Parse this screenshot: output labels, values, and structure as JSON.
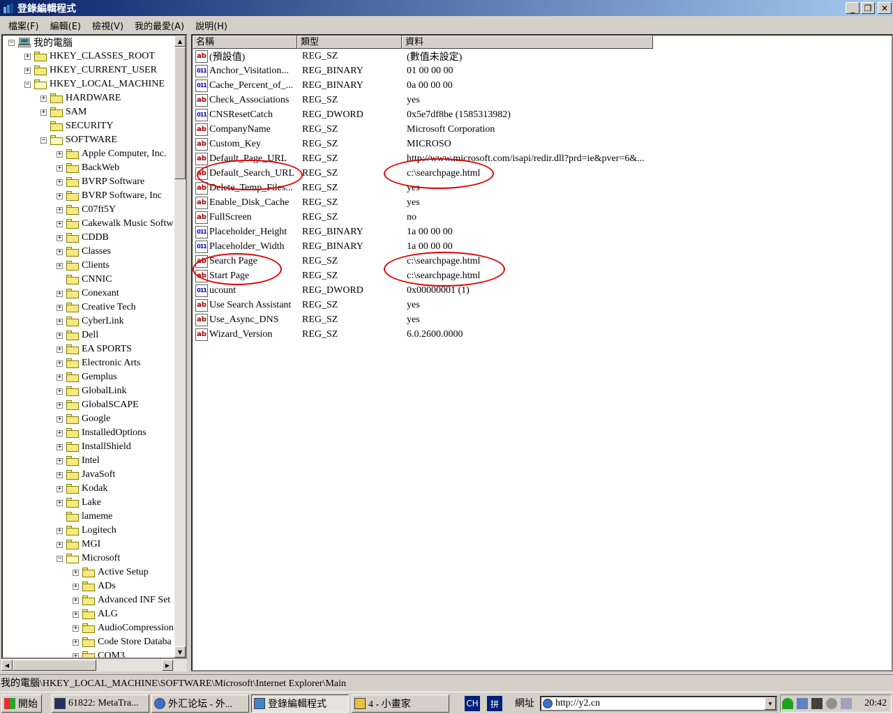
{
  "window": {
    "title": "登錄編輯程式",
    "min_label": "_",
    "restore_label": "❐",
    "close_label": "✕"
  },
  "menu": [
    "檔案(F)",
    "編輯(E)",
    "檢視(V)",
    "我的最愛(A)",
    "說明(H)"
  ],
  "tree": {
    "items": [
      {
        "label": "我的電腦",
        "exp": "−",
        "level": 0,
        "icon": "computer"
      },
      {
        "label": "HKEY_CLASSES_ROOT",
        "exp": "+",
        "level": 1
      },
      {
        "label": "HKEY_CURRENT_USER",
        "exp": "+",
        "level": 1
      },
      {
        "label": "HKEY_LOCAL_MACHINE",
        "exp": "−",
        "level": 1,
        "open": true
      },
      {
        "label": "HARDWARE",
        "exp": "+",
        "level": 2
      },
      {
        "label": "SAM",
        "exp": "+",
        "level": 2
      },
      {
        "label": "SECURITY",
        "exp": "",
        "level": 2
      },
      {
        "label": "SOFTWARE",
        "exp": "−",
        "level": 2,
        "open": true
      },
      {
        "label": "Apple Computer, Inc.",
        "exp": "+",
        "level": 3
      },
      {
        "label": "BackWeb",
        "exp": "+",
        "level": 3
      },
      {
        "label": "BVRP Software",
        "exp": "+",
        "level": 3
      },
      {
        "label": "BVRP Software, Inc",
        "exp": "+",
        "level": 3
      },
      {
        "label": "C07ft5Y",
        "exp": "+",
        "level": 3
      },
      {
        "label": "Cakewalk Music Softw",
        "exp": "+",
        "level": 3
      },
      {
        "label": "CDDB",
        "exp": "+",
        "level": 3
      },
      {
        "label": "Classes",
        "exp": "+",
        "level": 3
      },
      {
        "label": "Clients",
        "exp": "+",
        "level": 3
      },
      {
        "label": "CNNIC",
        "exp": "",
        "level": 3
      },
      {
        "label": "Conexant",
        "exp": "+",
        "level": 3
      },
      {
        "label": "Creative Tech",
        "exp": "+",
        "level": 3
      },
      {
        "label": "CyberLink",
        "exp": "+",
        "level": 3
      },
      {
        "label": "Dell",
        "exp": "+",
        "level": 3
      },
      {
        "label": "EA SPORTS",
        "exp": "+",
        "level": 3
      },
      {
        "label": "Electronic Arts",
        "exp": "+",
        "level": 3
      },
      {
        "label": "Gemplus",
        "exp": "+",
        "level": 3
      },
      {
        "label": "GlobalLink",
        "exp": "+",
        "level": 3
      },
      {
        "label": "GlobalSCAPE",
        "exp": "+",
        "level": 3
      },
      {
        "label": "Google",
        "exp": "+",
        "level": 3
      },
      {
        "label": "InstalledOptions",
        "exp": "+",
        "level": 3
      },
      {
        "label": "InstallShield",
        "exp": "+",
        "level": 3
      },
      {
        "label": "Intel",
        "exp": "+",
        "level": 3
      },
      {
        "label": "JavaSoft",
        "exp": "+",
        "level": 3
      },
      {
        "label": "Kodak",
        "exp": "+",
        "level": 3
      },
      {
        "label": "Lake",
        "exp": "+",
        "level": 3
      },
      {
        "label": "lameme",
        "exp": "",
        "level": 3
      },
      {
        "label": "Logitech",
        "exp": "+",
        "level": 3
      },
      {
        "label": "MGI",
        "exp": "+",
        "level": 3
      },
      {
        "label": "Microsoft",
        "exp": "−",
        "level": 3,
        "open": true
      },
      {
        "label": "Active Setup",
        "exp": "+",
        "level": 4
      },
      {
        "label": "ADs",
        "exp": "+",
        "level": 4
      },
      {
        "label": "Advanced INF Set",
        "exp": "+",
        "level": 4
      },
      {
        "label": "ALG",
        "exp": "+",
        "level": 4
      },
      {
        "label": "AudioCompression",
        "exp": "+",
        "level": 4
      },
      {
        "label": "Code Store Databa",
        "exp": "+",
        "level": 4
      },
      {
        "label": "COM3",
        "exp": "+",
        "level": 4
      }
    ]
  },
  "list": {
    "headers": [
      "名稱",
      "類型",
      "資料"
    ],
    "rows": [
      {
        "icon": "ab",
        "name": "(預設值)",
        "type": "REG_SZ",
        "data": "(數值未設定)"
      },
      {
        "icon": "bin",
        "name": "Anchor_Visitation...",
        "type": "REG_BINARY",
        "data": "01 00 00 00"
      },
      {
        "icon": "bin",
        "name": "Cache_Percent_of_...",
        "type": "REG_BINARY",
        "data": "0a 00 00 00"
      },
      {
        "icon": "ab",
        "name": "Check_Associations",
        "type": "REG_SZ",
        "data": "yes"
      },
      {
        "icon": "bin",
        "name": "CNSResetCatch",
        "type": "REG_DWORD",
        "data": "0x5e7df8be (1585313982)"
      },
      {
        "icon": "ab",
        "name": "CompanyName",
        "type": "REG_SZ",
        "data": "Microsoft Corporation"
      },
      {
        "icon": "ab",
        "name": "Custom_Key",
        "type": "REG_SZ",
        "data": "MICROSO"
      },
      {
        "icon": "ab",
        "name": "Default_Page_URL",
        "type": "REG_SZ",
        "data": "http://www.microsoft.com/isapi/redir.dll?prd=ie&pver=6&..."
      },
      {
        "icon": "ab",
        "name": "Default_Search_URL",
        "type": "REG_SZ",
        "data": "c:\\searchpage.html"
      },
      {
        "icon": "ab",
        "name": "Delete_Temp_Files...",
        "type": "REG_SZ",
        "data": "yes"
      },
      {
        "icon": "ab",
        "name": "Enable_Disk_Cache",
        "type": "REG_SZ",
        "data": "yes"
      },
      {
        "icon": "ab",
        "name": "FullScreen",
        "type": "REG_SZ",
        "data": "no"
      },
      {
        "icon": "bin",
        "name": "Placeholder_Height",
        "type": "REG_BINARY",
        "data": "1a 00 00 00"
      },
      {
        "icon": "bin",
        "name": "Placeholder_Width",
        "type": "REG_BINARY",
        "data": "1a 00 00 00"
      },
      {
        "icon": "ab",
        "name": "Search Page",
        "type": "REG_SZ",
        "data": "c:\\searchpage.html"
      },
      {
        "icon": "ab",
        "name": "Start Page",
        "type": "REG_SZ",
        "data": "c:\\searchpage.html"
      },
      {
        "icon": "bin",
        "name": "ucount",
        "type": "REG_DWORD",
        "data": "0x00000001 (1)"
      },
      {
        "icon": "ab",
        "name": "Use Search Assistant",
        "type": "REG_SZ",
        "data": "yes"
      },
      {
        "icon": "ab",
        "name": "Use_Async_DNS",
        "type": "REG_SZ",
        "data": "yes"
      },
      {
        "icon": "ab",
        "name": "Wizard_Version",
        "type": "REG_SZ",
        "data": "6.0.2600.0000"
      }
    ]
  },
  "annotation_color": "#e00000",
  "statusbar": {
    "path": "我的電腦\\HKEY_LOCAL_MACHINE\\SOFTWARE\\Microsoft\\Internet Explorer\\Main"
  },
  "taskbar": {
    "start": "開始",
    "buttons": [
      "61822: MetaTra...",
      "外汇论坛 - 外...",
      "登錄編輯程式",
      "4 - 小畫家"
    ],
    "lang1": "CH",
    "lang2": "拼",
    "address_label": "網址",
    "address_value": "http://y2.cn",
    "clock": "20:42"
  }
}
